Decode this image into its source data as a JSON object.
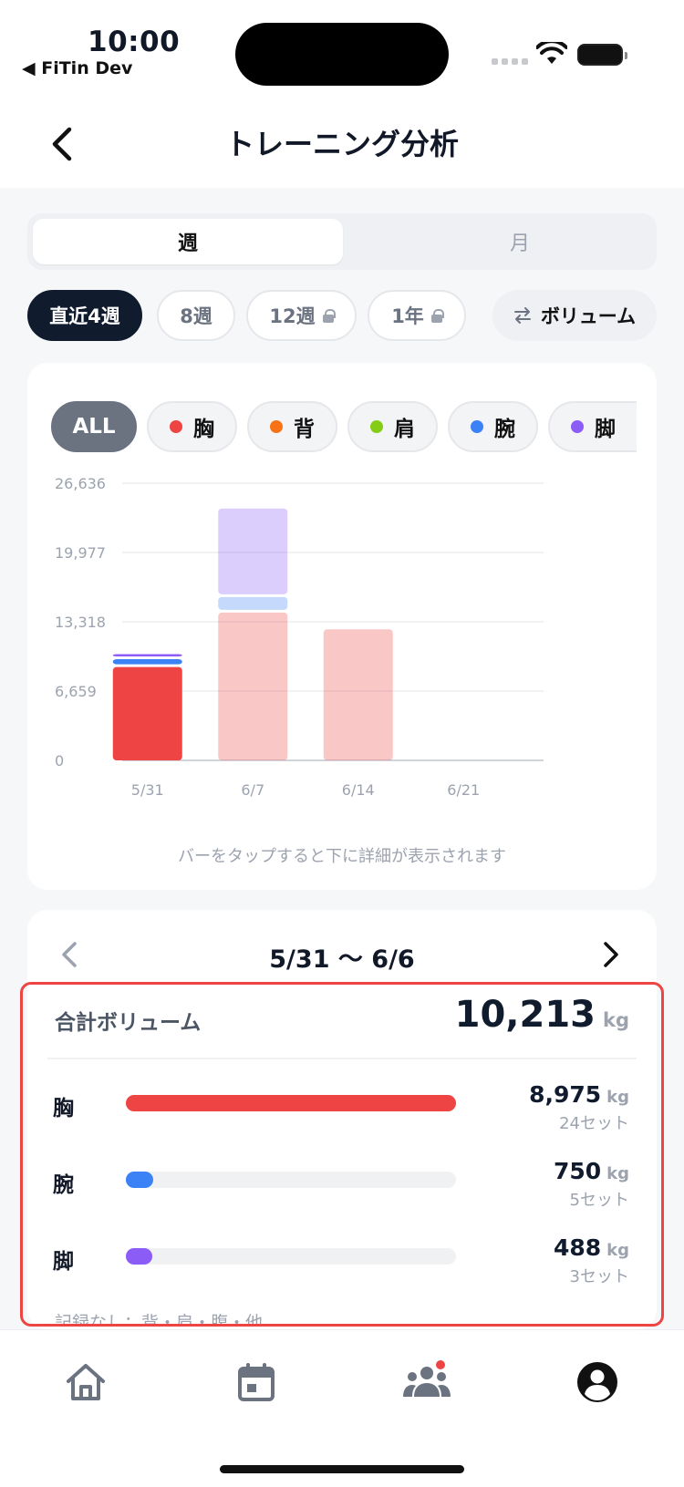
{
  "status": {
    "time": "10:00",
    "back_app": "◀ FiTin Dev"
  },
  "header": {
    "title": "トレーニング分析"
  },
  "segment": {
    "week": "週",
    "month": "月"
  },
  "range_chips": [
    {
      "label": "直近4週",
      "active": true,
      "locked": false
    },
    {
      "label": "8週",
      "active": false,
      "locked": false
    },
    {
      "label": "12週",
      "active": false,
      "locked": true
    },
    {
      "label": "1年",
      "active": false,
      "locked": true
    }
  ],
  "metric_toggle": {
    "icon": "swap-icon",
    "label": "ボリューム"
  },
  "filters": [
    {
      "label": "ALL",
      "color": null
    },
    {
      "label": "胸",
      "color": "#ef4444"
    },
    {
      "label": "背",
      "color": "#f97316"
    },
    {
      "label": "肩",
      "color": "#84cc16"
    },
    {
      "label": "腕",
      "color": "#3b82f6"
    },
    {
      "label": "脚",
      "color": "#8b5cf6"
    }
  ],
  "chart_data": {
    "type": "bar",
    "stacked": true,
    "categories": [
      "5/31",
      "6/7",
      "6/14",
      "6/21"
    ],
    "yticks": [
      "0",
      "6,659",
      "13,318",
      "19,977",
      "26,636"
    ],
    "ylim": [
      0,
      26636
    ],
    "series": [
      {
        "name": "胸",
        "color": "#ef4444",
        "values": [
          8975,
          14200,
          12600,
          0
        ]
      },
      {
        "name": "腕",
        "color": "#3b82f6",
        "values": [
          750,
          1500,
          0,
          0
        ]
      },
      {
        "name": "脚",
        "color": "#8b5cf6",
        "values": [
          488,
          8500,
          0,
          0
        ]
      }
    ],
    "selected_index": 0,
    "grid": true,
    "hint": "バーをタップすると下に詳細が表示されます"
  },
  "detail": {
    "week_label": "5/31 〜 6/6",
    "total_label": "合計ボリューム",
    "total_value": "10,213",
    "unit": "kg",
    "rows": [
      {
        "label": "胸",
        "value": "8,975",
        "sets": "24セット",
        "color": "#ef4444",
        "ratio": 1.0
      },
      {
        "label": "腕",
        "value": "750",
        "sets": "5セット",
        "color": "#3b82f6",
        "ratio": 0.084
      },
      {
        "label": "脚",
        "value": "488",
        "sets": "3セット",
        "color": "#8b5cf6",
        "ratio": 0.054
      }
    ],
    "no_record": "記録なし：背・肩・腹・他"
  },
  "tabs": [
    {
      "name": "home",
      "active": false
    },
    {
      "name": "calendar",
      "active": false
    },
    {
      "name": "community",
      "active": false,
      "badge": true
    },
    {
      "name": "profile",
      "active": true
    }
  ]
}
